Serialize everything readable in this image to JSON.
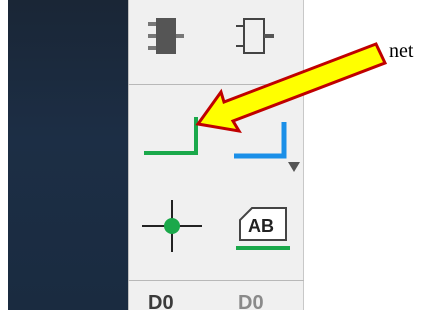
{
  "annotation": {
    "label": "net"
  },
  "toolbar": {
    "tools": [
      {
        "name": "symbol-component-icon"
      },
      {
        "name": "symbol-pin-icon"
      },
      {
        "name": "net-wire-icon"
      },
      {
        "name": "bus-icon"
      },
      {
        "name": "junction-icon"
      },
      {
        "name": "net-label-icon"
      }
    ],
    "net_label_text": "AB",
    "partial_left": "D0",
    "partial_right": "D0"
  },
  "colors": {
    "wire_green": "#1aa84a",
    "bus_blue": "#1a8fe8",
    "arrow_fill": "#ffff00",
    "arrow_stroke": "#c00000"
  }
}
